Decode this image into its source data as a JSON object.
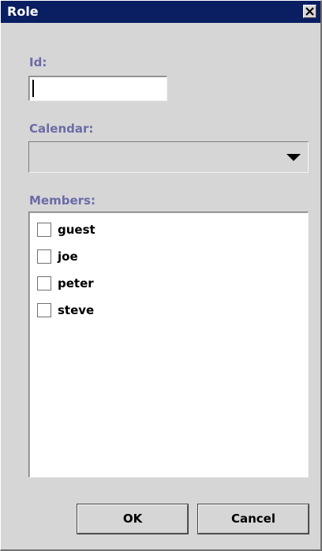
{
  "window": {
    "title": "Role"
  },
  "form": {
    "id_label": "Id:",
    "id_value": "",
    "calendar_label": "Calendar:",
    "calendar_value": "",
    "members_label": "Members:",
    "members": [
      {
        "label": "guest",
        "checked": false
      },
      {
        "label": "joe",
        "checked": false
      },
      {
        "label": "peter",
        "checked": false
      },
      {
        "label": "steve",
        "checked": false
      }
    ]
  },
  "buttons": {
    "ok_label": "OK",
    "cancel_label": "Cancel"
  },
  "icons": {
    "close": "close-icon",
    "dropdown": "chevron-down-icon"
  },
  "colors": {
    "titlebar": "#0a1f62",
    "label": "#6b6ba8",
    "window_bg": "#d6d6d6"
  }
}
